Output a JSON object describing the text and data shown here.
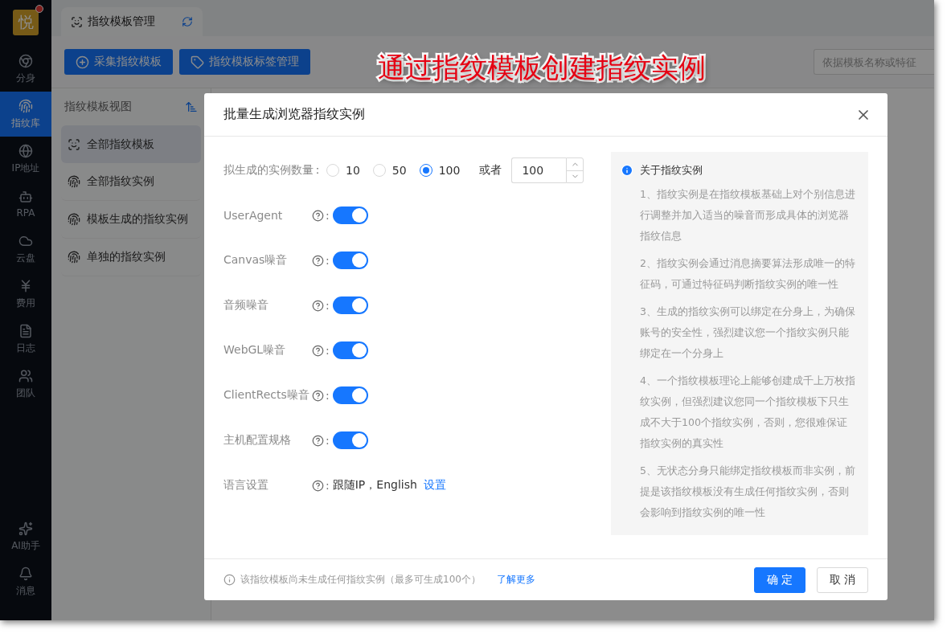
{
  "sidebar": {
    "logo": "悦",
    "items": [
      {
        "label": "分身",
        "selected": false
      },
      {
        "label": "指纹库",
        "selected": true
      },
      {
        "label": "IP地址",
        "selected": false
      },
      {
        "label": "RPA",
        "selected": false
      },
      {
        "label": "云盘",
        "selected": false
      },
      {
        "label": "费用",
        "selected": false
      },
      {
        "label": "日志",
        "selected": false
      },
      {
        "label": "团队",
        "selected": false
      }
    ],
    "bottom_items": [
      {
        "label": "AI助手"
      },
      {
        "label": "消息"
      }
    ]
  },
  "tab": {
    "label": "指纹模板管理"
  },
  "toolbar": {
    "buttons": [
      {
        "label": "采集指纹模板"
      },
      {
        "label": "指纹模板标签管理"
      }
    ],
    "search": {
      "placeholder": "依据模板名称或特征"
    }
  },
  "annotation": "通过指纹模板创建指纹实例",
  "template_panel": {
    "title": "指纹模板视图",
    "items": [
      {
        "label": "全部指纹模板",
        "selected": true
      },
      {
        "label": "全部指纹实例",
        "selected": false
      },
      {
        "label": "模板生成的指纹实例",
        "selected": false
      },
      {
        "label": "单独的指纹实例",
        "selected": false
      }
    ]
  },
  "dialog": {
    "title": "批量生成浏览器指纹实例",
    "count": {
      "label": "拟生成的实例数量",
      "options": [
        {
          "label": "10",
          "selected": false
        },
        {
          "label": "50",
          "selected": false
        },
        {
          "label": "100",
          "selected": true
        }
      ],
      "colon": "：",
      "or_label": "或者",
      "value": "100"
    },
    "switches": [
      {
        "label": "UserAgent",
        "colon": ":",
        "on": true
      },
      {
        "label": "Canvas噪音",
        "colon": ":",
        "on": true
      },
      {
        "label": "音频噪音",
        "colon": ":",
        "on": true
      },
      {
        "label": "WebGL噪音",
        "colon": ":",
        "on": true
      },
      {
        "label": "ClientRects噪音",
        "colon": ":",
        "on": true
      },
      {
        "label": "主机配置规格",
        "colon": ":",
        "on": true
      }
    ],
    "language": {
      "label": "语言设置",
      "colon": ":",
      "value": "跟随IP，English",
      "link": "设置"
    },
    "info": {
      "title": "关于指纹实例",
      "items": [
        "1、指纹实例是在指纹模板基础上对个别信息进行调整并加入适当的噪音而形成具体的浏览器指纹信息",
        "2、指纹实例会通过消息摘要算法形成唯一的特征码，可通过特征码判断指纹实例的唯一性",
        "3、生成的指纹实例可以绑定在分身上，为确保账号的安全性，强烈建议您一个指纹实例只能绑定在一个分身上",
        "4、一个指纹模板理论上能够创建成千上万枚指纹实例，但强烈建议您同一个指纹模板下只生成不大于100个指纹实例，否则，您很难保证指纹实例的真实性",
        "5、无状态分身只能绑定指纹模板而非实例，前提是该指纹模板没有生成任何指纹实例，否则会影响到指纹实例的唯一性"
      ]
    },
    "footer": {
      "note": "该指纹模板尚未生成任何指纹实例（最多可生成100个）",
      "link": "了解更多",
      "buttons": [
        {
          "label": "确 定",
          "kind": "primary"
        },
        {
          "label": "取 消",
          "kind": "default"
        }
      ]
    }
  }
}
